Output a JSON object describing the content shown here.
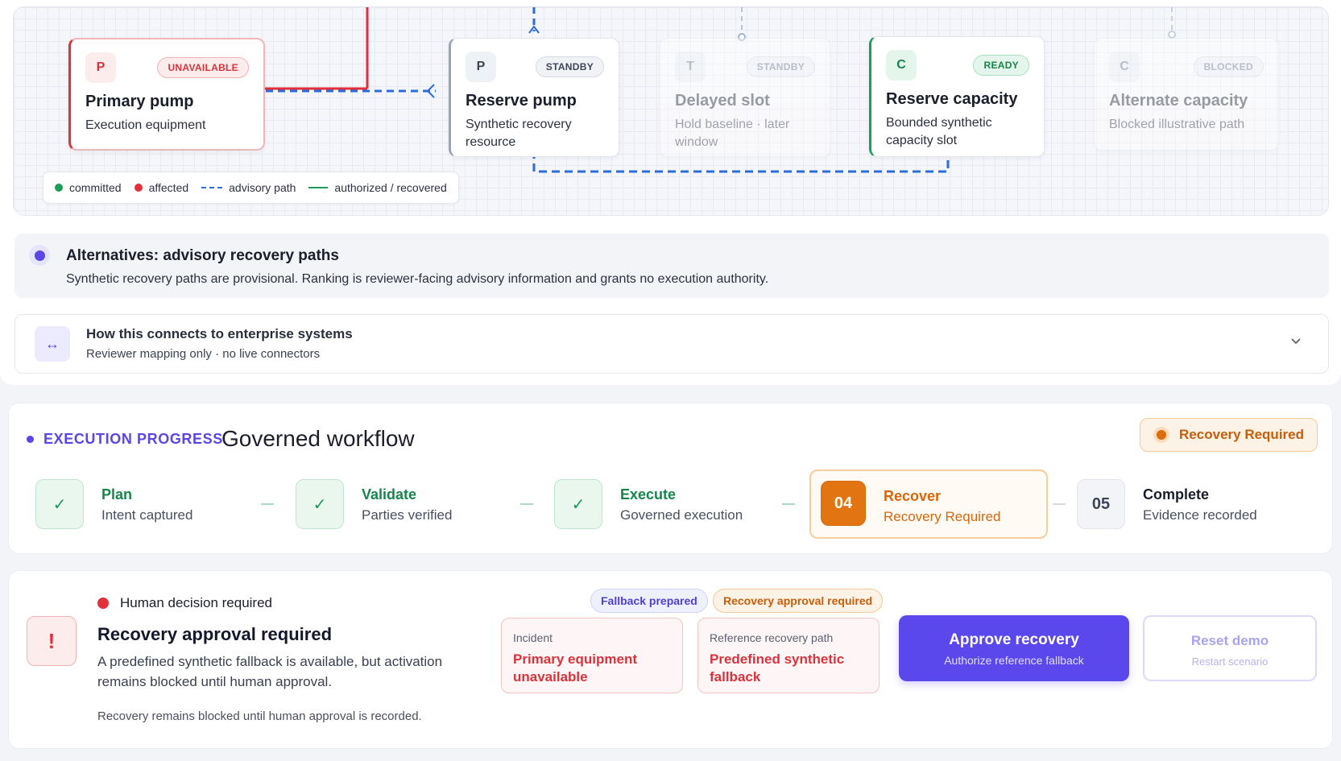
{
  "diagram": {
    "nodes": [
      {
        "tag": "P",
        "badge": "UNAVAILABLE",
        "title": "Primary pump",
        "sub": "Execution equipment"
      },
      {
        "tag": "P",
        "badge": "STANDBY",
        "title": "Reserve pump",
        "sub": "Synthetic recovery resource"
      },
      {
        "tag": "T",
        "badge": "STANDBY",
        "title": "Delayed slot",
        "sub": "Hold baseline · later window"
      },
      {
        "tag": "C",
        "badge": "READY",
        "title": "Reserve capacity",
        "sub": "Bounded synthetic capacity slot"
      },
      {
        "tag": "C",
        "badge": "BLOCKED",
        "title": "Alternate capacity",
        "sub": "Blocked illustrative path"
      }
    ],
    "legend": {
      "committed": "committed",
      "affected": "affected",
      "advisory": "advisory path",
      "authorized": "authorized / recovered"
    },
    "colors": {
      "committed": "#1d9b59",
      "affected": "#e2303b",
      "advisory": "#2d6cdf",
      "accent": "#5a45e8"
    }
  },
  "alternatives": {
    "title": "Alternatives: advisory recovery paths",
    "text": "Synthetic recovery paths are provisional. Ranking is reviewer-facing advisory information and grants no execution authority."
  },
  "connects": {
    "icon": "↔",
    "title": "How this connects to enterprise systems",
    "sub": "Reviewer mapping only · no live connectors"
  },
  "progress": {
    "eyebrow": "EXECUTION PROGRESS",
    "heading": "Governed workflow",
    "status": "Recovery Required",
    "steps": [
      {
        "marker": "✓",
        "name": "Plan",
        "desc": "Intent captured"
      },
      {
        "marker": "✓",
        "name": "Validate",
        "desc": "Parties verified"
      },
      {
        "marker": "✓",
        "name": "Execute",
        "desc": "Governed execution"
      },
      {
        "marker": "04",
        "name": "Recover",
        "desc": "Recovery Required"
      },
      {
        "marker": "05",
        "name": "Complete",
        "desc": "Evidence recorded"
      }
    ]
  },
  "decision": {
    "icon": "!",
    "kicker": "Human decision required",
    "title": "Recovery approval required",
    "body": "A predefined synthetic fallback is available, but activation remains blocked until human approval.",
    "footnote": "Recovery remains blocked until human approval is recorded.",
    "pills": {
      "fallback": "Fallback prepared",
      "approval": "Recovery approval required"
    },
    "incident": {
      "label": "Incident",
      "value": "Primary equipment unavailable"
    },
    "reference": {
      "label": "Reference recovery path",
      "value": "Predefined synthetic fallback"
    },
    "approve": {
      "label": "Approve recovery",
      "sub": "Authorize reference fallback"
    },
    "reset": {
      "label": "Reset demo",
      "sub": "Restart scenario"
    }
  }
}
